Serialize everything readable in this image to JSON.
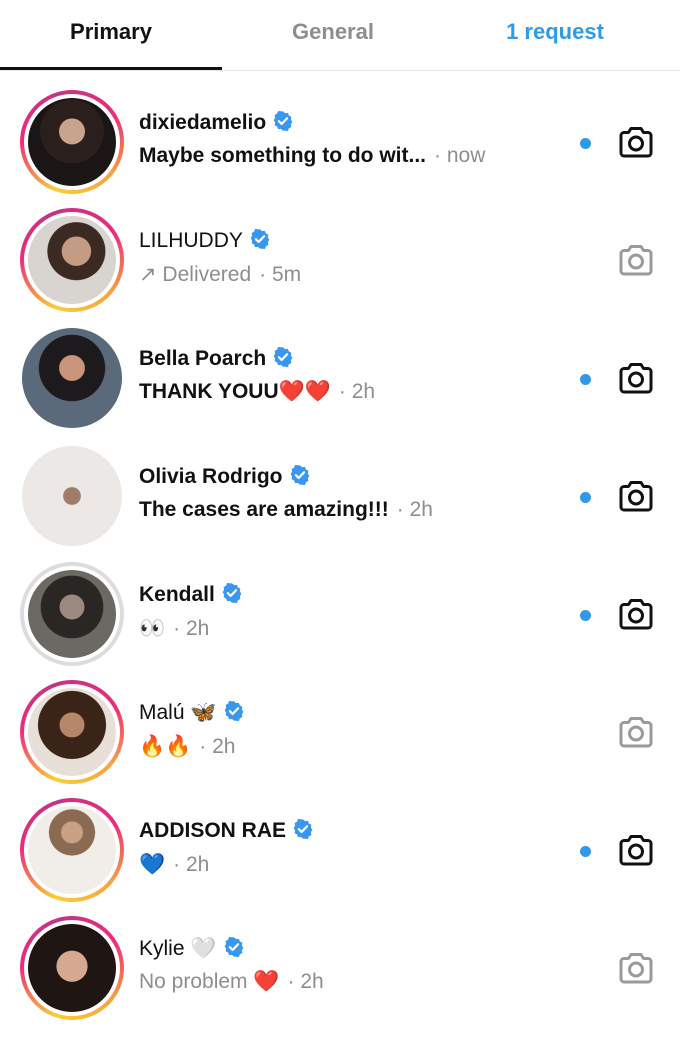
{
  "tabs": {
    "primary": "Primary",
    "general": "General",
    "requests": "1 request"
  },
  "colors": {
    "accent": "#2f9ae8",
    "verified": "#3897f0",
    "unread_dot": "#2f9ae8"
  },
  "icons": {
    "verified": "verified-badge-icon",
    "camera": "camera-icon"
  },
  "conversations": [
    {
      "name": "dixiedamelio",
      "message": "Maybe something to do wit...",
      "time": "· now",
      "unread": true,
      "story_ring": true
    },
    {
      "name": "LILHUDDY",
      "message": "↗ Delivered",
      "time": "· 5m",
      "unread": false,
      "story_ring": true
    },
    {
      "name": "Bella Poarch",
      "message": "THANK YOUU❤️❤️",
      "time": "· 2h",
      "unread": true,
      "story_ring": false
    },
    {
      "name": "Olivia Rodrigo",
      "message": "The cases are amazing!!!",
      "time": "· 2h",
      "unread": true,
      "story_ring": false
    },
    {
      "name": "Kendall",
      "message": "👀",
      "time": "· 2h",
      "unread": true,
      "story_ring": "seen"
    },
    {
      "name": "Malú 🦋",
      "message": "🔥🔥",
      "time": "· 2h",
      "unread": false,
      "story_ring": true
    },
    {
      "name": "ADDISON RAE",
      "message": "💙",
      "time": "· 2h",
      "unread": true,
      "story_ring": true
    },
    {
      "name": "Kylie 🤍",
      "message": "No problem ❤️",
      "time": "· 2h",
      "unread": false,
      "story_ring": true
    }
  ]
}
